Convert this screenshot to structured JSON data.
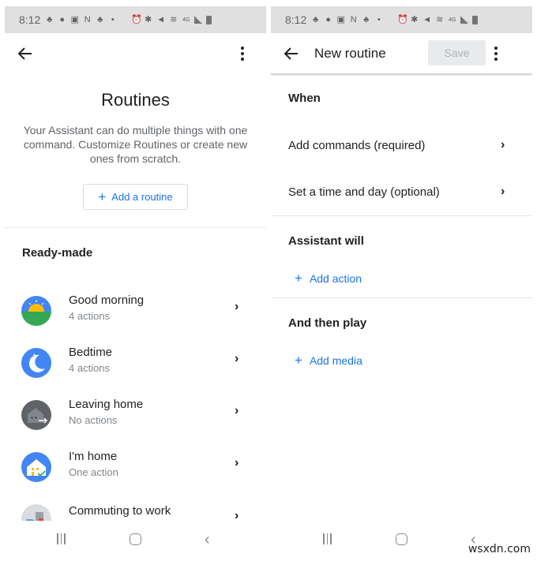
{
  "status_bar": {
    "time": "8:12",
    "left_icons": [
      "notification-icon",
      "messenger-icon",
      "gallery-icon",
      "nfc-icon",
      "notification-icon",
      "dot-icon"
    ],
    "right_icons": [
      "alarm-icon",
      "bluetooth-icon",
      "mute-icon",
      "wifi-icon",
      "4g-lte-icon",
      "signal-icon",
      "battery-icon"
    ],
    "network_label": "4G"
  },
  "left_screen": {
    "title": "Routines",
    "description": "Your Assistant can do multiple things with one command. Customize Routines or create new ones from scratch.",
    "add_routine_label": "Add a routine",
    "section_title": "Ready-made",
    "routines": [
      {
        "name": "Good morning",
        "subtitle": "4 actions",
        "icon": "sunrise-icon"
      },
      {
        "name": "Bedtime",
        "subtitle": "4 actions",
        "icon": "moon-icon"
      },
      {
        "name": "Leaving home",
        "subtitle": "No actions",
        "icon": "leaving-home-icon"
      },
      {
        "name": "I'm home",
        "subtitle": "One action",
        "icon": "home-check-icon"
      },
      {
        "name": "Commuting to work",
        "subtitle": "",
        "icon": "commute-icon"
      }
    ]
  },
  "right_screen": {
    "title": "New routine",
    "save_label": "Save",
    "when_title": "When",
    "when_items": [
      {
        "label": "Add commands (required)"
      },
      {
        "label": "Set a time and day (optional)"
      }
    ],
    "assistant_will_title": "Assistant will",
    "add_action_label": "Add action",
    "and_then_play_title": "And then play",
    "add_media_label": "Add media"
  },
  "watermark": "wsxdn.com"
}
